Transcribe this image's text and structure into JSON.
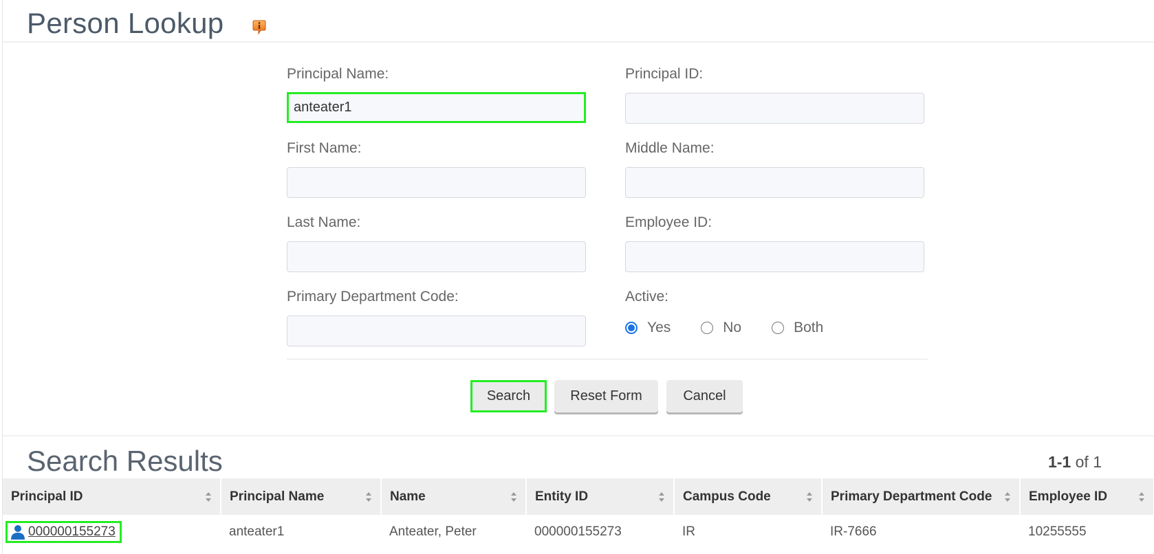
{
  "page": {
    "title": "Person Lookup",
    "help_icon": "info-balloon-icon"
  },
  "form": {
    "principal_name": {
      "label": "Principal Name:",
      "value": "anteater1"
    },
    "principal_id": {
      "label": "Principal ID:",
      "value": ""
    },
    "first_name": {
      "label": "First Name:",
      "value": ""
    },
    "middle_name": {
      "label": "Middle Name:",
      "value": ""
    },
    "last_name": {
      "label": "Last Name:",
      "value": ""
    },
    "employee_id": {
      "label": "Employee ID:",
      "value": ""
    },
    "primary_department_code": {
      "label": "Primary Department Code:",
      "value": ""
    },
    "active": {
      "label": "Active:",
      "options": [
        {
          "label": "Yes",
          "checked": true
        },
        {
          "label": "No",
          "checked": false
        },
        {
          "label": "Both",
          "checked": false
        }
      ]
    }
  },
  "buttons": {
    "search": "Search",
    "reset": "Reset Form",
    "cancel": "Cancel"
  },
  "results": {
    "title": "Search Results",
    "pager": {
      "range": "1-1",
      "of_text": "of 1"
    },
    "columns": [
      "Principal ID",
      "Principal Name",
      "Name",
      "Entity ID",
      "Campus Code",
      "Primary Department Code",
      "Employee ID"
    ],
    "rows": [
      {
        "principal_id": "000000155273",
        "principal_name": "anteater1",
        "name": "Anteater, Peter",
        "entity_id": "000000155273",
        "campus_code": "IR",
        "primary_department_code": "IR-7666",
        "employee_id": "10255555"
      }
    ]
  },
  "colors": {
    "highlight": "#22ee22",
    "radio_accent": "#1a73e8",
    "person_icon": "#1a6fc2"
  }
}
